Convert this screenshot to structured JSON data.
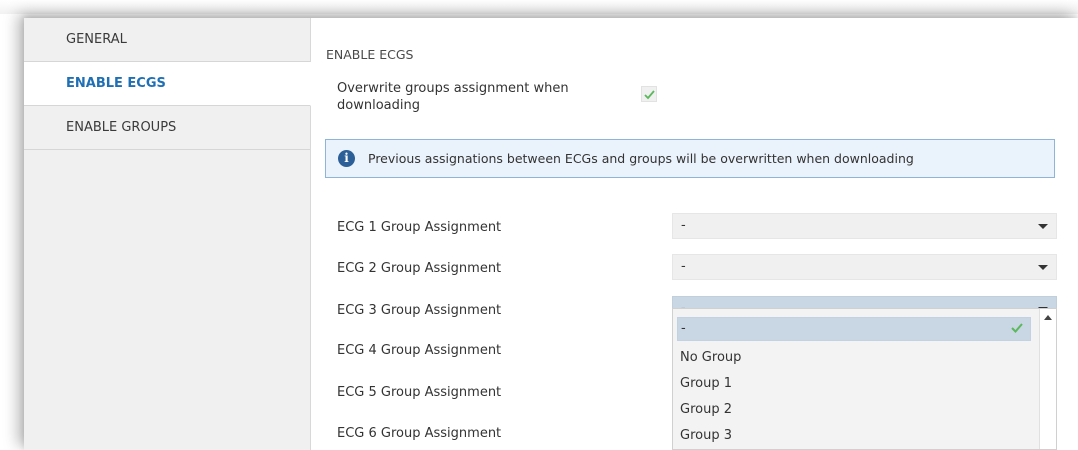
{
  "sidebar": {
    "items": [
      {
        "label": "GENERAL",
        "active": false
      },
      {
        "label": "ENABLE ECGS",
        "active": true
      },
      {
        "label": "ENABLE GROUPS",
        "active": false
      }
    ]
  },
  "main": {
    "section_title": "ENABLE ECGS",
    "overwrite": {
      "label": "Overwrite groups assignment when downloading",
      "checked": true
    },
    "info": {
      "icon": "info-icon",
      "text": "Previous assignations between ECGs and groups will be overwritten when downloading"
    },
    "assignments": [
      {
        "label": "ECG 1 Group Assignment",
        "value": "-"
      },
      {
        "label": "ECG 2 Group Assignment",
        "value": "-"
      },
      {
        "label": "ECG 3 Group Assignment",
        "value": "-"
      },
      {
        "label": "ECG 4 Group Assignment",
        "value": ""
      },
      {
        "label": "ECG 5 Group Assignment",
        "value": ""
      },
      {
        "label": "ECG 6 Group Assignment",
        "value": ""
      }
    ],
    "dropdown": {
      "options": [
        "-",
        "No Group",
        "Group 1",
        "Group 2",
        "Group 3"
      ],
      "selected": "-"
    }
  },
  "colors": {
    "accent": "#1f6fb5",
    "check": "#5cb85c",
    "info_border": "#8fb4da",
    "info_bg": "#eaf2fb",
    "selected_bg": "#c9d6e3"
  }
}
